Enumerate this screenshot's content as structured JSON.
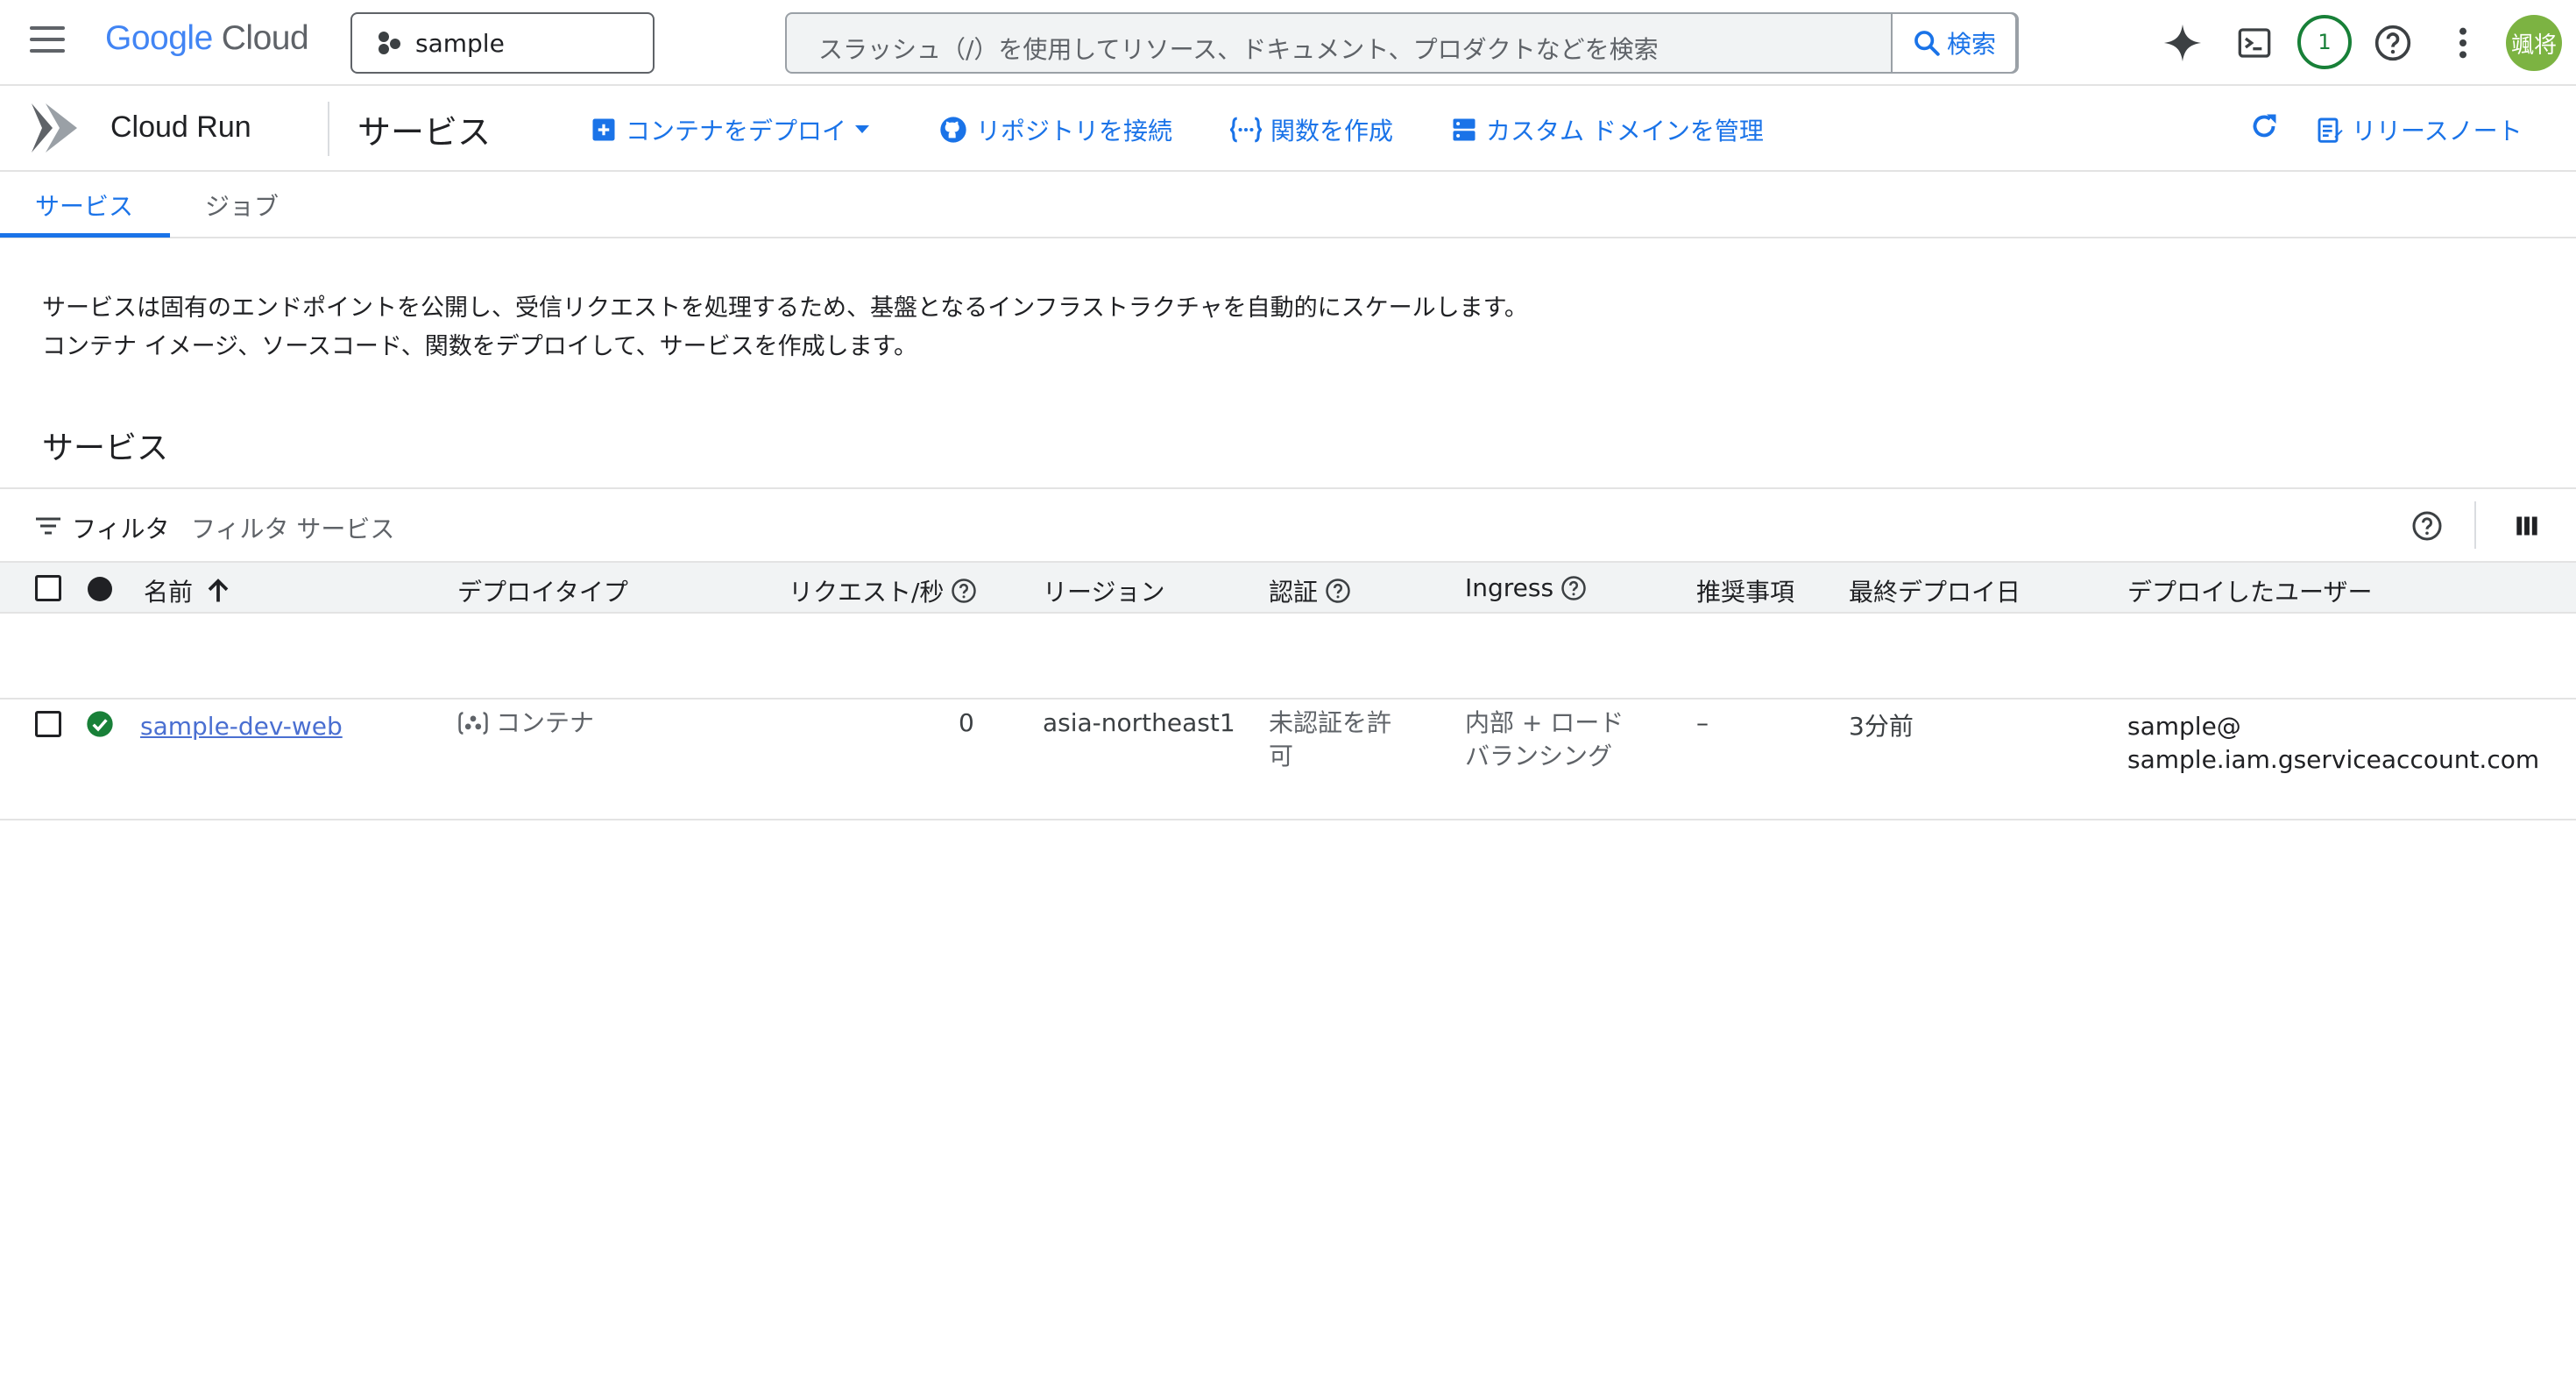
{
  "header": {
    "logo_google": "Google",
    "logo_cloud": "Cloud",
    "project_name": "sample",
    "search_placeholder": "スラッシュ（/）を使用してリソース、ドキュメント、プロダクトなどを検索",
    "search_button": "検索",
    "notification_count": "1",
    "avatar_text": "颯将"
  },
  "toolbar": {
    "product": "Cloud Run",
    "page_title": "サービス",
    "actions": {
      "deploy_container": "コンテナをデプロイ",
      "connect_repo": "リポジトリを接続",
      "create_function": "関数を作成",
      "manage_domains": "カスタム ドメインを管理",
      "release_notes": "リリースノート"
    }
  },
  "tabs": {
    "services": "サービス",
    "jobs": "ジョブ"
  },
  "description": {
    "line1": "サービスは固有のエンドポイントを公開し、受信リクエストを処理するため、基盤となるインフラストラクチャを自動的にスケールします。",
    "line2": "コンテナ イメージ、ソースコード、関数をデプロイして、サービスを作成します。"
  },
  "section_title": "サービス",
  "filter": {
    "label": "フィルタ",
    "placeholder": "フィルタ サービス"
  },
  "table": {
    "columns": {
      "name": "名前",
      "deploy_type": "デプロイタイプ",
      "requests": "リクエスト/秒",
      "region": "リージョン",
      "auth": "認証",
      "ingress": "Ingress",
      "recommendations": "推奨事項",
      "last_deployed": "最終デプロイ日",
      "deployed_by": "デプロイしたユーザー"
    },
    "rows": [
      {
        "name": "sample-dev-web",
        "deploy_type": "コンテナ",
        "requests": "0",
        "region": "asia-northeast1",
        "auth_line1": "未認証を許",
        "auth_line2": "可",
        "ingress_line1": "内部 + ロード",
        "ingress_line2": "バランシング",
        "recommendations": "–",
        "last_deployed": "3分前",
        "deployed_by_line1": "sample@",
        "deployed_by_line2": "sample.iam.gserviceaccount.com"
      }
    ]
  },
  "colors": {
    "accent": "#1a73e8",
    "success": "#188038",
    "avatar": "#7cb342"
  }
}
